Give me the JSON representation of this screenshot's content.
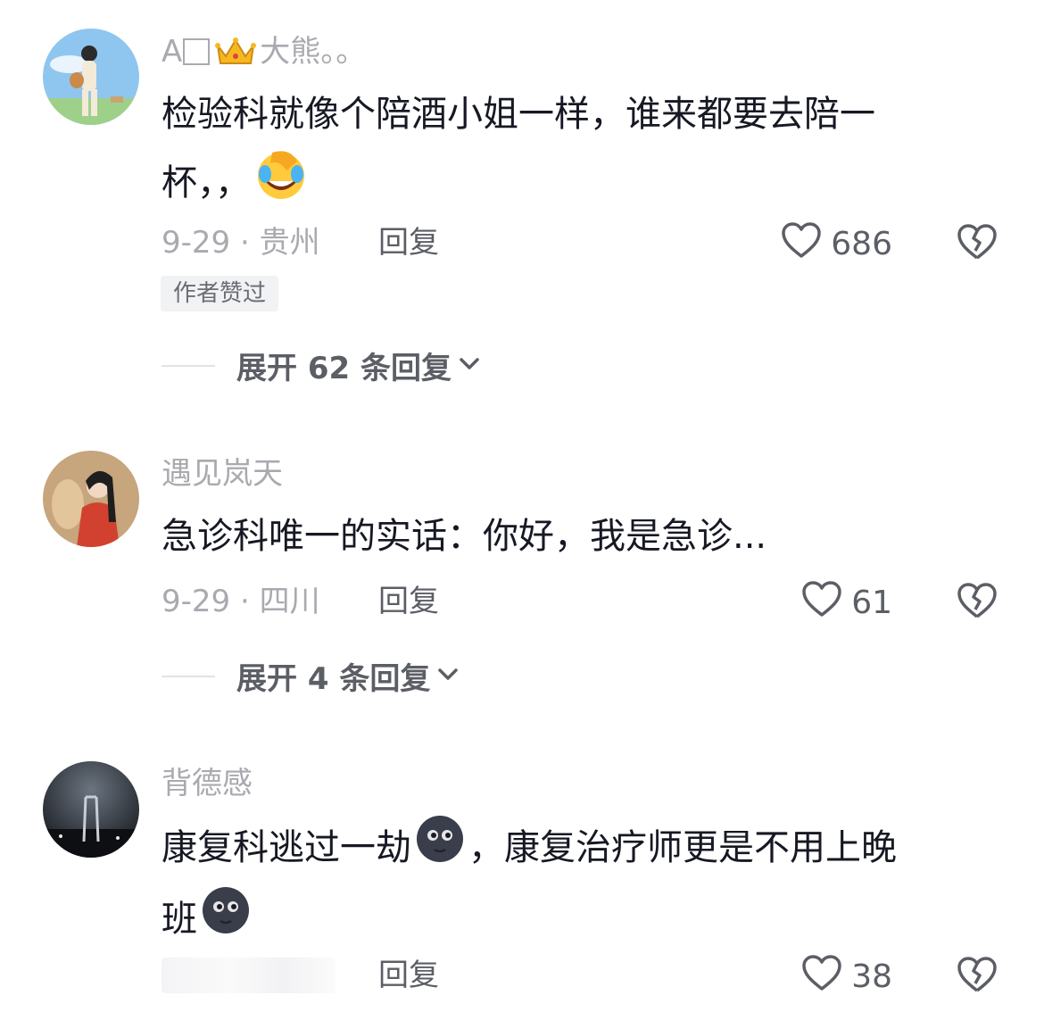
{
  "comments": [
    {
      "username_prefix": "A",
      "username": "大熊。。",
      "text_line1": "检验科就像个陪酒小姐一样，谁来都要去陪一",
      "text_line2": "杯，，",
      "emoji": "facepalm-laugh-emoji",
      "date_location": "9-29 · 贵州",
      "reply_label": "回复",
      "likes": "686",
      "author_badge": "作者赞过",
      "expand_label": "展开 62 条回复"
    },
    {
      "username": "遇见岚天",
      "text_line1": "急诊科唯一的实话：你好，我是急诊...",
      "date_location": "9-29 · 四川",
      "reply_label": "回复",
      "likes": "61",
      "expand_label": "展开 4 条回复"
    },
    {
      "username": "背德感",
      "text_line1_a": "康复科逃过一劫",
      "text_line1_b": "，康复治疗师更是不用上晚",
      "text_line2": "班",
      "emoji": "moon-face-emoji",
      "reply_label": "回复",
      "likes": "38"
    }
  ],
  "colors": {
    "username": "#a9aab0",
    "text": "#161823",
    "secondary": "#5c5e66"
  },
  "icons": {
    "like": "heart-outline-icon",
    "dislike": "broken-heart-icon",
    "expand": "chevron-down-icon"
  }
}
